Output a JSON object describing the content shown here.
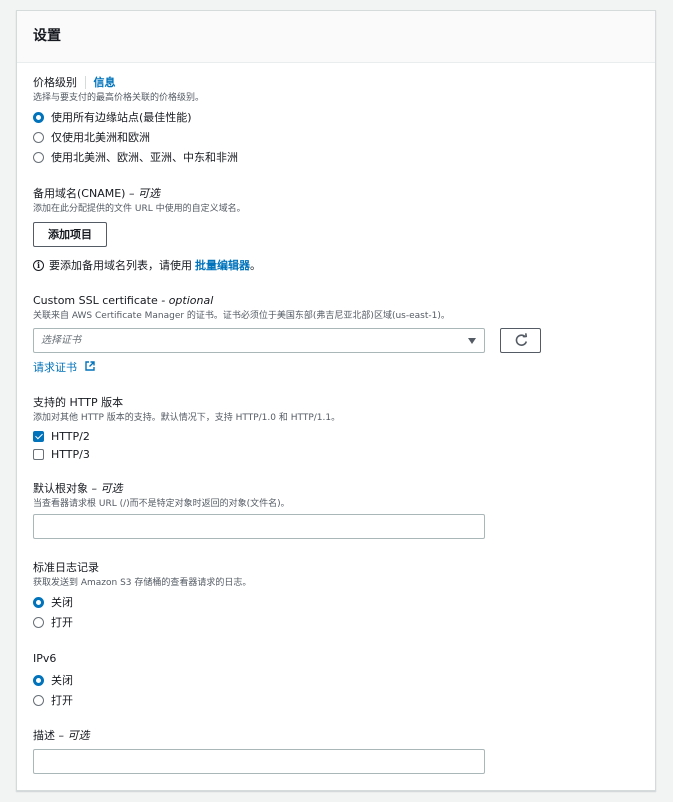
{
  "panel": {
    "title": "设置"
  },
  "price_class": {
    "label": "价格级别",
    "info": "信息",
    "description": "选择与要支付的最高价格关联的价格级别。",
    "options": [
      {
        "label": "使用所有边缘站点(最佳性能)",
        "selected": true
      },
      {
        "label": "仅使用北美洲和欧洲",
        "selected": false
      },
      {
        "label": "使用北美洲、欧洲、亚洲、中东和非洲",
        "selected": false
      }
    ]
  },
  "cname": {
    "label": "备用域名(CNAME)",
    "optional": "– 可选",
    "description": "添加在此分配提供的文件 URL 中使用的自定义域名。",
    "add_button": "添加项目",
    "info_text": "要添加备用域名列表，请使用",
    "bulk_editor_link": "批量编辑器",
    "info_suffix": "。"
  },
  "ssl": {
    "label": "Custom SSL certificate",
    "optional": "- optional",
    "description": "关联来自 AWS Certificate Manager 的证书。证书必须位于美国东部(弗吉尼亚北部)区域(us-east-1)。",
    "select_placeholder": "选择证书",
    "request_link": "请求证书"
  },
  "http": {
    "label": "支持的 HTTP 版本",
    "description": "添加对其他 HTTP 版本的支持。默认情况下，支持 HTTP/1.0 和 HTTP/1.1。",
    "options": [
      {
        "label": "HTTP/2",
        "checked": true
      },
      {
        "label": "HTTP/3",
        "checked": false
      }
    ]
  },
  "root_object": {
    "label": "默认根对象",
    "optional": "– 可选",
    "description": "当查看器请求根 URL (/)而不是特定对象时返回的对象(文件名)。",
    "value": ""
  },
  "logging": {
    "label": "标准日志记录",
    "description": "获取发送到 Amazon S3 存储桶的查看器请求的日志。",
    "options": [
      {
        "label": "关闭",
        "selected": true
      },
      {
        "label": "打开",
        "selected": false
      }
    ]
  },
  "ipv6": {
    "label": "IPv6",
    "options": [
      {
        "label": "关闭",
        "selected": true
      },
      {
        "label": "打开",
        "selected": false
      }
    ]
  },
  "description_field": {
    "label": "描述",
    "optional": "– 可选",
    "value": ""
  },
  "colors": {
    "accent": "#0073bb",
    "border": "#aab7b8"
  },
  "icons": {
    "info": "info-circle-icon",
    "refresh": "refresh-icon",
    "external": "external-link-icon",
    "caret": "caret-down-icon"
  }
}
